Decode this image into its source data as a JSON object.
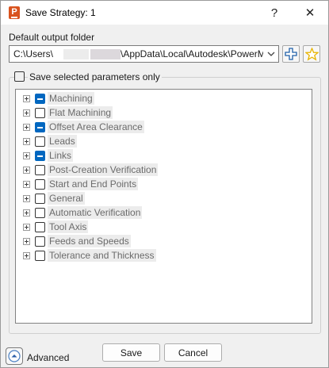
{
  "window": {
    "title": "Save Strategy: 1",
    "app_icon_letter": "P",
    "help_glyph": "?",
    "close_glyph": "✕"
  },
  "output_folder": {
    "label": "Default output folder",
    "path_start": "C:\\Users\\",
    "path_end": "\\AppData\\Local\\Autodesk\\PowerMill\\"
  },
  "save_selected": {
    "label": "Save selected parameters only",
    "checked": false
  },
  "tree": {
    "items": [
      {
        "label": "Machining",
        "state": "partial"
      },
      {
        "label": "Flat Machining",
        "state": "unchecked"
      },
      {
        "label": "Offset Area Clearance",
        "state": "partial"
      },
      {
        "label": "Leads",
        "state": "unchecked"
      },
      {
        "label": "Links",
        "state": "partial"
      },
      {
        "label": "Post-Creation Verification",
        "state": "unchecked"
      },
      {
        "label": "Start and End Points",
        "state": "unchecked"
      },
      {
        "label": "General",
        "state": "unchecked"
      },
      {
        "label": "Automatic Verification",
        "state": "unchecked"
      },
      {
        "label": "Tool Axis",
        "state": "unchecked"
      },
      {
        "label": "Feeds and Speeds",
        "state": "unchecked"
      },
      {
        "label": "Tolerance and Thickness",
        "state": "unchecked"
      }
    ]
  },
  "footer": {
    "advanced_label": "Advanced",
    "save_label": "Save",
    "cancel_label": "Cancel"
  },
  "colors": {
    "accent": "#0067c0",
    "app_icon": "#d9531e",
    "star": "#e8b400"
  },
  "icons": {
    "add": "plus-cross-icon",
    "favorite": "star-icon",
    "advanced": "chevron-up-icon"
  }
}
